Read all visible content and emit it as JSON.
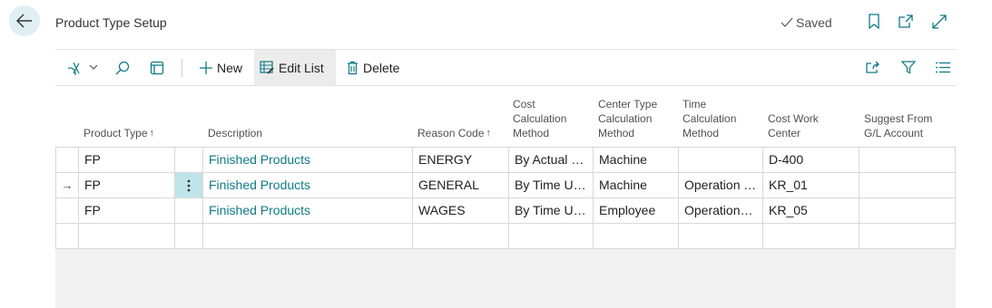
{
  "header": {
    "title": "Product Type Setup",
    "saved_label": "Saved"
  },
  "toolbar": {
    "new_label": "New",
    "edit_list_label": "Edit List",
    "delete_label": "Delete"
  },
  "columns": {
    "product_type": "Product Type",
    "description": "Description",
    "reason_code": "Reason Code",
    "cost_calc_1": "Cost",
    "cost_calc_2": "Calculation",
    "cost_calc_3": "Method",
    "center_type_1": "Center Type",
    "center_type_2": "Calculation",
    "center_type_3": "Method",
    "time_calc_1": "Time",
    "time_calc_2": "Calculation",
    "time_calc_3": "Method",
    "cost_wc_1": "Cost Work",
    "cost_wc_2": "Center",
    "suggest_1": "Suggest From",
    "suggest_2": "G/L Account",
    "sort_indicator": "↑"
  },
  "rows": [
    {
      "product_type": "FP",
      "description": "Finished Products",
      "reason_code": "ENERGY",
      "cost_calc": "By Actual Pr...",
      "center_type": "Machine",
      "time_calc": "",
      "cost_wc": "D-400",
      "suggest": ""
    },
    {
      "product_type": "FP",
      "description": "Finished Products",
      "reason_code": "GENERAL",
      "cost_calc": "By Time Used",
      "center_type": "Machine",
      "time_calc": "Operation T...",
      "cost_wc": "KR_01",
      "suggest": ""
    },
    {
      "product_type": "FP",
      "description": "Finished Products",
      "reason_code": "WAGES",
      "cost_calc": "By Time Used",
      "center_type": "Employee",
      "time_calc": "Operation+...",
      "cost_wc": "KR_05",
      "suggest": ""
    }
  ],
  "current_row_marker": "→",
  "colors": {
    "accent": "#0f7a87",
    "selected_cell": "#bfe5ea",
    "back_button_bg": "#dfeff3"
  }
}
